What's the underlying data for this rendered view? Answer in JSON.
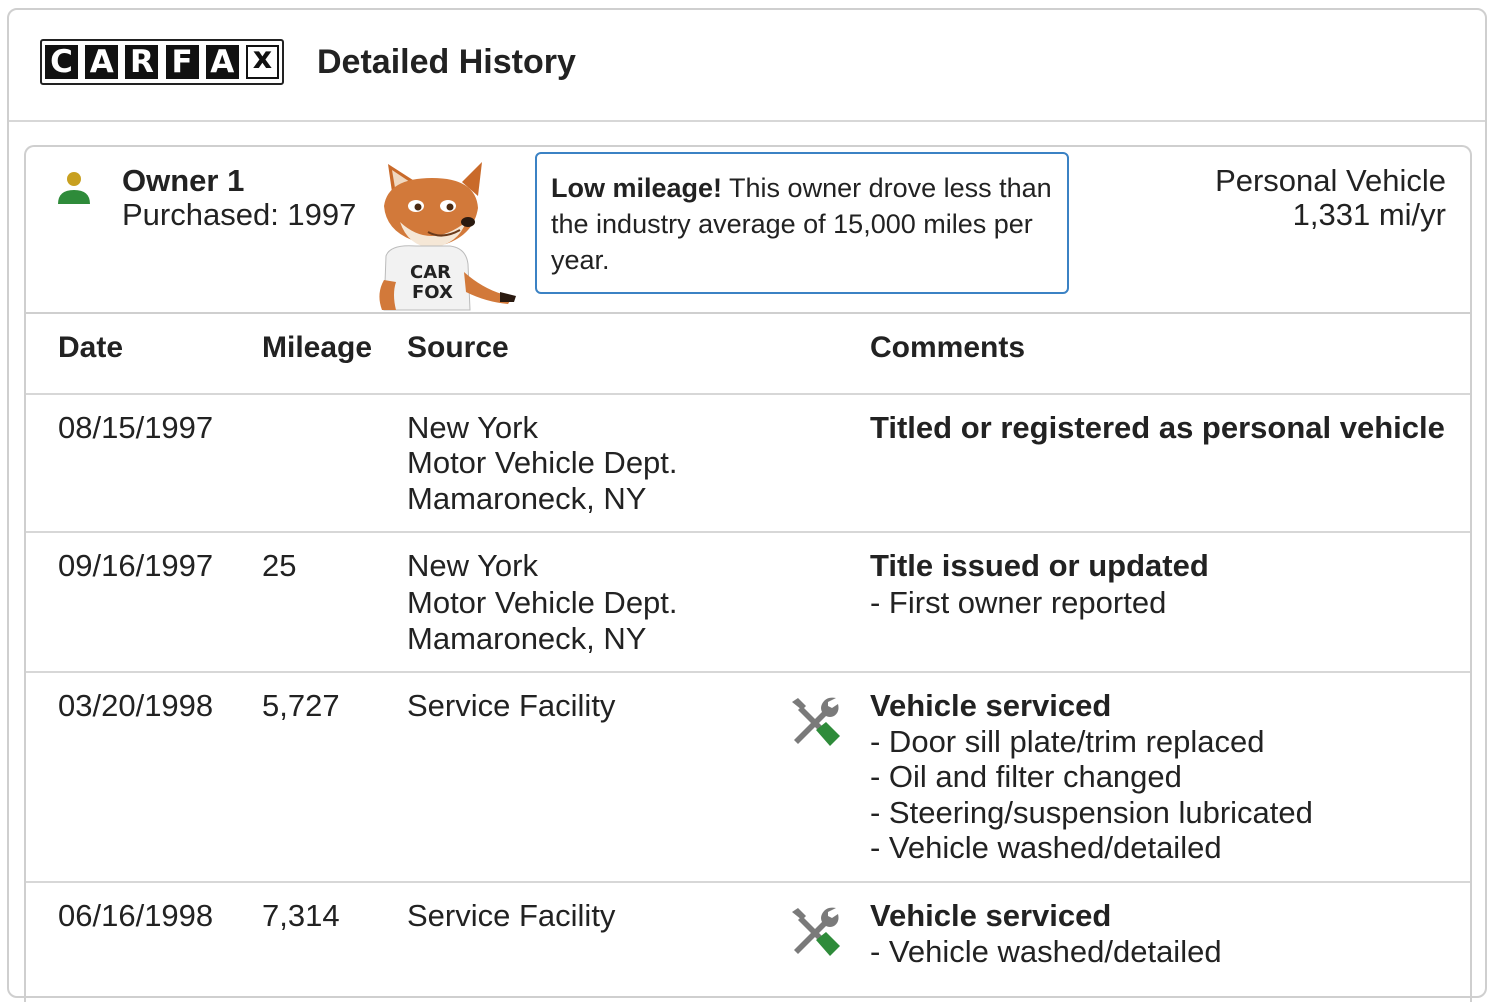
{
  "header": {
    "logo_letters": [
      "C",
      "A",
      "R",
      "F",
      "A",
      "X"
    ],
    "title": "Detailed History"
  },
  "owner": {
    "name": "Owner 1",
    "purchased": "Purchased: 1997",
    "mascot_shirt": "CAR FOX",
    "note_bold": "Low mileage!",
    "note_text": " This owner drove less than the industry average of 15,000 miles per year.",
    "vehicle_type": "Personal Vehicle",
    "miles_per_year": "1,331 mi/yr"
  },
  "table": {
    "headers": {
      "date": "Date",
      "mileage": "Mileage",
      "source": "Source",
      "comments": "Comments"
    },
    "rows": [
      {
        "date": "08/15/1997",
        "mileage": "",
        "source": [
          "New York",
          "Motor Vehicle Dept.",
          "Mamaroneck, NY"
        ],
        "comment_title": "Titled or registered as personal vehicle",
        "comment_items": []
      },
      {
        "date": "09/16/1997",
        "mileage": "25",
        "source": [
          "New York",
          "Motor Vehicle Dept.",
          "Mamaroneck, NY"
        ],
        "comment_title": "Title issued or updated",
        "comment_items": [
          "- First owner reported"
        ]
      },
      {
        "date": "03/20/1998",
        "mileage": "5,727",
        "source": [
          "Service Facility"
        ],
        "icon": "tools-icon",
        "comment_title": "Vehicle serviced",
        "comment_items": [
          "- Door sill plate/trim replaced",
          "- Oil and filter changed",
          "- Steering/suspension lubricated",
          "- Vehicle washed/detailed"
        ]
      },
      {
        "date": "06/16/1998",
        "mileage": "7,314",
        "source": [
          "Service Facility"
        ],
        "icon": "tools-icon",
        "comment_title": "Vehicle serviced",
        "comment_items": [
          "- Vehicle washed/detailed"
        ]
      }
    ]
  },
  "colors": {
    "note_border": "#3b82c4",
    "icon_green": "#2e8b3a",
    "icon_gold": "#c8a020",
    "icon_gray": "#7a7a7a"
  }
}
